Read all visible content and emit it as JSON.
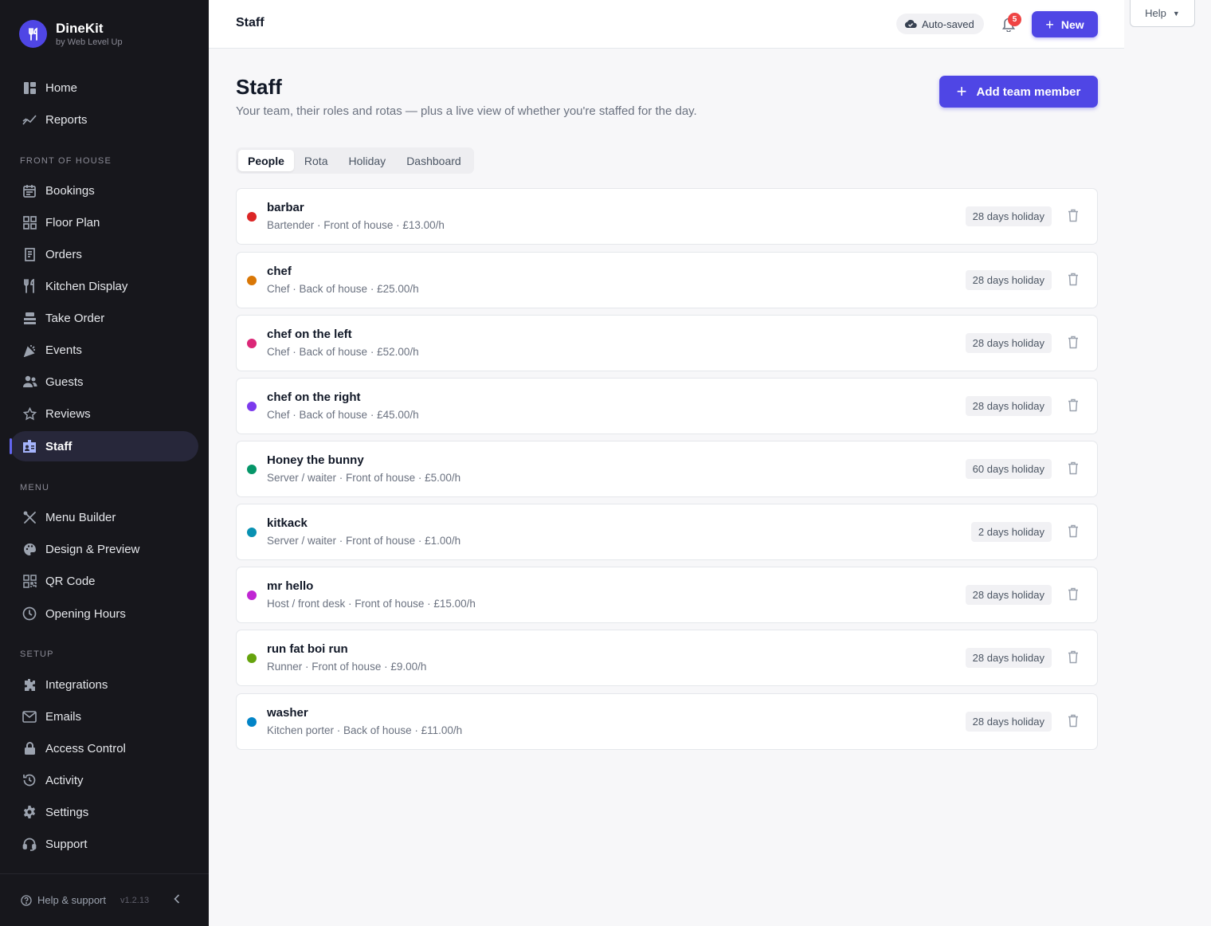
{
  "app": {
    "name": "DineKit",
    "byline": "by Web Level Up"
  },
  "sidebar": {
    "top_items": [
      {
        "label": "Home",
        "icon": "grid-icon"
      },
      {
        "label": "Reports",
        "icon": "chart-icon"
      }
    ],
    "sections": [
      {
        "label": "FRONT OF HOUSE",
        "items": [
          {
            "label": "Bookings",
            "icon": "calendar-icon"
          },
          {
            "label": "Floor Plan",
            "icon": "floorplan-icon"
          },
          {
            "label": "Orders",
            "icon": "receipt-icon"
          },
          {
            "label": "Kitchen Display",
            "icon": "cutlery-icon"
          },
          {
            "label": "Take Order",
            "icon": "register-icon"
          },
          {
            "label": "Events",
            "icon": "party-icon"
          },
          {
            "label": "Guests",
            "icon": "users-icon"
          },
          {
            "label": "Reviews",
            "icon": "star-icon"
          },
          {
            "label": "Staff",
            "icon": "badge-icon",
            "active": true
          }
        ]
      },
      {
        "label": "MENU",
        "items": [
          {
            "label": "Menu Builder",
            "icon": "tools-icon"
          },
          {
            "label": "Design & Preview",
            "icon": "palette-icon"
          },
          {
            "label": "QR Code",
            "icon": "qr-icon"
          },
          {
            "label": "Opening Hours",
            "icon": "clock-icon"
          }
        ]
      },
      {
        "label": "SETUP",
        "items": [
          {
            "label": "Integrations",
            "icon": "puzzle-icon"
          },
          {
            "label": "Emails",
            "icon": "mail-icon"
          },
          {
            "label": "Access Control",
            "icon": "lock-icon"
          },
          {
            "label": "Activity",
            "icon": "history-icon"
          },
          {
            "label": "Settings",
            "icon": "gear-icon"
          },
          {
            "label": "Support",
            "icon": "headset-icon"
          }
        ]
      }
    ],
    "footer": {
      "help_label": "Help & support",
      "version": "v1.2.13"
    }
  },
  "topbar": {
    "title": "Staff",
    "autosaved": "Auto-saved",
    "notification_count": "5",
    "new_label": "New"
  },
  "help": {
    "label": "Help"
  },
  "page": {
    "title": "Staff",
    "subtitle": "Your team, their roles and rotas — plus a live view of whether you're staffed for the day.",
    "add_button": "Add team member",
    "tabs": [
      {
        "label": "People",
        "active": true
      },
      {
        "label": "Rota"
      },
      {
        "label": "Holiday"
      },
      {
        "label": "Dashboard"
      }
    ]
  },
  "staff": [
    {
      "name": "barbar",
      "meta": "Bartender · Front of house · £13.00/h",
      "holiday": "28 days holiday",
      "color": "#dc2626"
    },
    {
      "name": "chef",
      "meta": "Chef · Back of house · £25.00/h",
      "holiday": "28 days holiday",
      "color": "#d97706"
    },
    {
      "name": "chef on the left",
      "meta": "Chef · Back of house · £52.00/h",
      "holiday": "28 days holiday",
      "color": "#db2777"
    },
    {
      "name": "chef on the right",
      "meta": "Chef · Back of house · £45.00/h",
      "holiday": "28 days holiday",
      "color": "#7c3aed"
    },
    {
      "name": "Honey the bunny",
      "meta": "Server / waiter · Front of house · £5.00/h",
      "holiday": "60 days holiday",
      "color": "#059669"
    },
    {
      "name": "kitkack",
      "meta": "Server / waiter · Front of house · £1.00/h",
      "holiday": "2 days holiday",
      "color": "#0891b2"
    },
    {
      "name": "mr hello",
      "meta": "Host / front desk · Front of house · £15.00/h",
      "holiday": "28 days holiday",
      "color": "#c026d3"
    },
    {
      "name": "run fat boi run",
      "meta": "Runner · Front of house · £9.00/h",
      "holiday": "28 days holiday",
      "color": "#65a30d"
    },
    {
      "name": "washer",
      "meta": "Kitchen porter · Back of house · £11.00/h",
      "holiday": "28 days holiday",
      "color": "#0284c7"
    }
  ]
}
